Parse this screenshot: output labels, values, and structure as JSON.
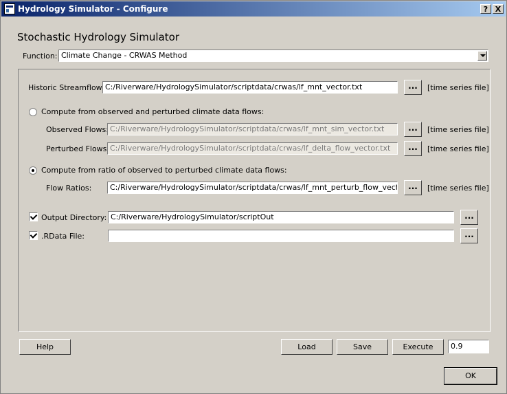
{
  "window": {
    "title": "Hydrology Simulator - Configure",
    "help_glyph": "?",
    "close_glyph": "X"
  },
  "heading": "Stochastic Hydrology Simulator",
  "function": {
    "label": "Function:",
    "selected": "Climate Change - CRWAS Method"
  },
  "historic": {
    "label": "Historic Streamflows:",
    "value": "C:/Riverware/HydrologySimulator/scriptdata/crwas/lf_mnt_vector.txt",
    "type_label": "[time series file]"
  },
  "option_observed": {
    "label": "Compute from observed and perturbed climate data flows:",
    "observed_label": "Observed Flows:",
    "observed_value": "C:/Riverware/HydrologySimulator/scriptdata/crwas/lf_mnt_sim_vector.txt",
    "perturbed_label": "Perturbed Flows:",
    "perturbed_value": "C:/Riverware/HydrologySimulator/scriptdata/crwas/lf_delta_flow_vector.txt",
    "type_label": "[time series file]"
  },
  "option_ratio": {
    "label": "Compute from ratio of observed to perturbed climate data flows:",
    "ratios_label": "Flow Ratios:",
    "ratios_value": "C:/Riverware/HydrologySimulator/scriptdata/crwas/lf_mnt_perturb_flow_vector.txt",
    "type_label": "[time series file]"
  },
  "output_dir": {
    "label": "Output Directory:",
    "value": "C:/Riverware/HydrologySimulator/scriptOut"
  },
  "rdata": {
    "label": ".RData File:",
    "value": ""
  },
  "browse_label": "...",
  "buttons": {
    "help": "Help",
    "load": "Load",
    "save": "Save",
    "execute": "Execute",
    "ok": "OK"
  },
  "execute_value": "0.9"
}
